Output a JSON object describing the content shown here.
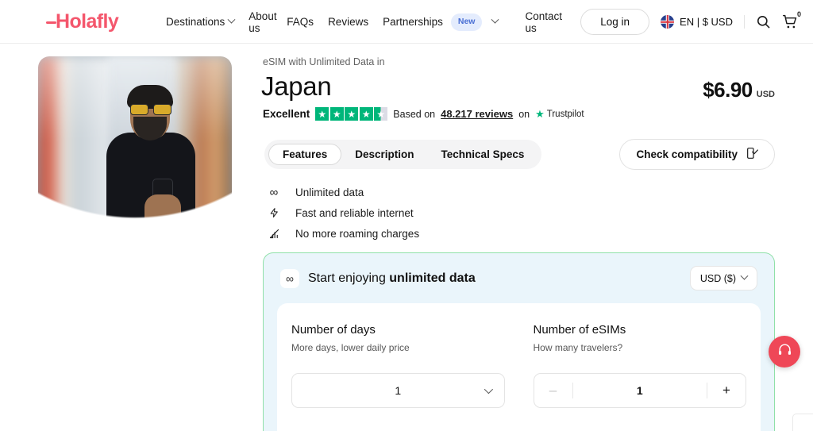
{
  "header": {
    "logo_text": "Holafly",
    "nav": [
      {
        "label": "Destinations",
        "icon": "chevron-down-icon",
        "badge": null
      },
      {
        "label": "About us",
        "icon": null,
        "badge": null
      },
      {
        "label": "FAQs",
        "icon": null,
        "badge": null
      },
      {
        "label": "Reviews",
        "icon": null,
        "badge": null
      },
      {
        "label": "Partnerships",
        "icon": "chevron-down-icon",
        "badge": "New"
      },
      {
        "label": "Contact us",
        "icon": null,
        "badge": null
      }
    ],
    "login_label": "Log in",
    "locale_label": "EN | $ USD",
    "flag_icon": "uk-flag-icon",
    "search_icon": "search-icon",
    "cart_icon": "cart-icon",
    "cart_count": "0"
  },
  "product": {
    "eyebrow": "eSIM with Unlimited Data in",
    "title": "Japan",
    "price_amount": "$6.90",
    "price_currency": "USD"
  },
  "trustpilot": {
    "rating_label": "Excellent",
    "stars_filled": 4.5,
    "based_on": "Based on",
    "reviews_link": "48.217 reviews",
    "on_word": "on",
    "brand": "Trustpilot"
  },
  "tabs": {
    "items": [
      "Features",
      "Description",
      "Technical Specs"
    ],
    "active": "Features",
    "compatibility_label": "Check compatibility",
    "compatibility_icon": "phone-check-icon"
  },
  "features": [
    {
      "icon": "infinity-icon",
      "label": "Unlimited data"
    },
    {
      "icon": "lightning-icon",
      "label": "Fast and reliable internet"
    },
    {
      "icon": "no-roaming-icon",
      "label": "No more roaming charges"
    }
  ],
  "panel": {
    "icon": "infinity-icon",
    "title_prefix": "Start enjoying ",
    "title_bold": "unlimited data",
    "currency_value": "USD ($)",
    "currency_icon": "chevron-down-icon",
    "days": {
      "title": "Number of days",
      "subtitle": "More days, lower daily price",
      "value": "1",
      "icon": "chevron-down-icon"
    },
    "esims": {
      "title": "Number of eSIMs",
      "subtitle": "How many travelers?",
      "value": "1",
      "minus": "–",
      "plus": "+"
    }
  },
  "support": {
    "icon": "headset-icon"
  },
  "colors": {
    "brand": "#f4566c",
    "panel_border": "#8fe0a8",
    "panel_bg": "#eaf5fb",
    "trust_green": "#00b67a",
    "badge_blue": "#4a6fd4",
    "fab_red": "#ef4757"
  }
}
